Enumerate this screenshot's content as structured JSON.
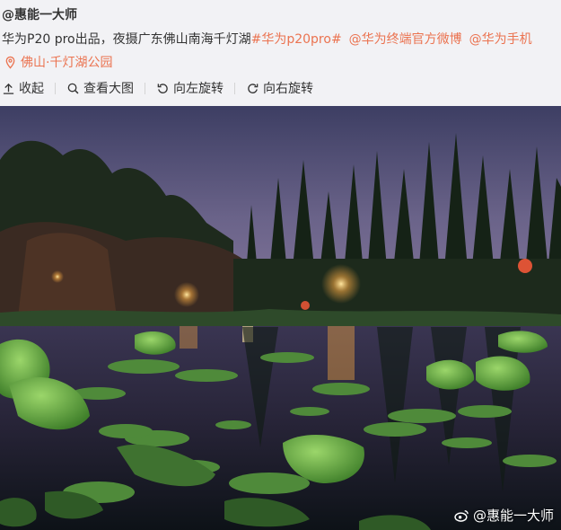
{
  "post": {
    "author": "@惠能一大师",
    "text": "华为P20 pro出品，夜摄广东佛山南海千灯湖",
    "hashtag": "#华为p20pro#",
    "mentions": [
      "@华为终端官方微博",
      "@华为手机"
    ],
    "location": "佛山·千灯湖公园"
  },
  "toolbar": {
    "collapse": "收起",
    "view_large": "查看大图",
    "rotate_left": "向左旋转",
    "rotate_right": "向右旋转"
  },
  "watermark": "@惠能一大师",
  "colors": {
    "link": "#eb7350",
    "text": "#333333"
  }
}
